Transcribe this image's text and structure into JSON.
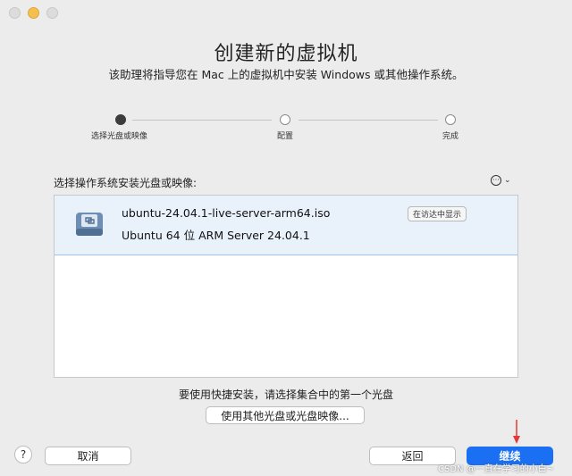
{
  "window": {
    "title": "创建新的虚拟机",
    "subtitle": "该助理将指导您在 Mac 上的虚拟机中安装 Windows 或其他操作系统。"
  },
  "steps": [
    {
      "label": "选择光盘或映像",
      "active": true
    },
    {
      "label": "配置",
      "active": false
    },
    {
      "label": "完成",
      "active": false
    }
  ],
  "source": {
    "label": "选择操作系统安装光盘或映像:",
    "more_icon": "ellipsis-circle-icon",
    "items": [
      {
        "file": "ubuntu-24.04.1-live-server-arm64.iso",
        "os": "Ubuntu 64 位 ARM Server 24.04.1",
        "finder_label": "在访达中显示",
        "icon": "disk-image-icon"
      }
    ]
  },
  "hint": "要使用快捷安装，请选择集合中的第一个光盘",
  "buttons": {
    "other_disk": "使用其他光盘或光盘映像...",
    "help": "?",
    "cancel": "取消",
    "back": "返回",
    "continue": "继续"
  },
  "watermark": "CSDN @一直在学习的小白~",
  "colors": {
    "accent": "#1a6ff2",
    "selection": "#e9f1fb",
    "annotation_arrow": "#e53935"
  }
}
